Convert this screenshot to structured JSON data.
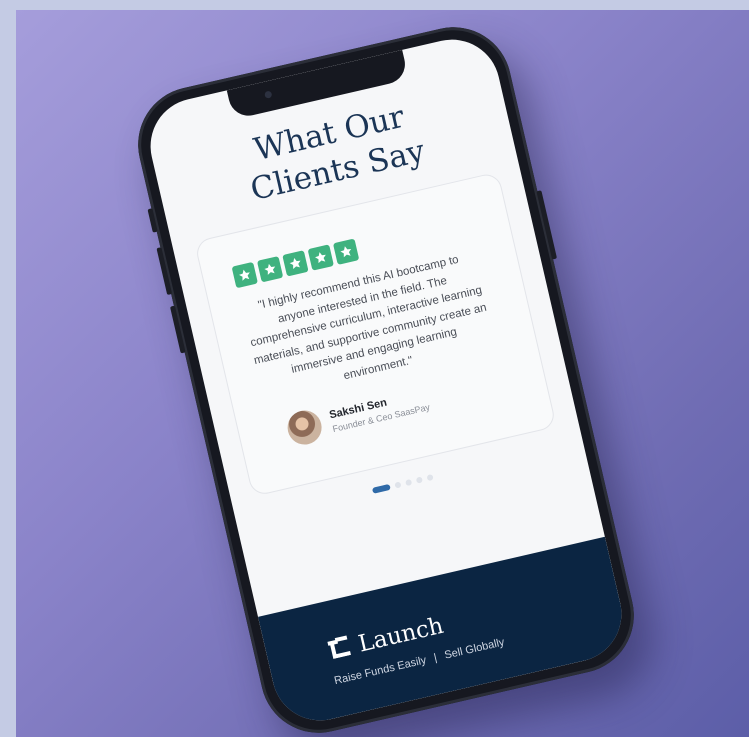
{
  "section": {
    "heading_line1": "What Our",
    "heading_line2": "Clients Say"
  },
  "testimonial": {
    "rating": 5,
    "rating_color": "#3fb27f",
    "quote": "\"I highly recommend this AI bootcamp to anyone interested in the field. The comprehensive curriculum, interactive learning materials, and supportive community create an immersive and engaging learning environment.\"",
    "author_name": "Sakshi Sen",
    "author_role": "Founder & Ceo SaasPay"
  },
  "carousel": {
    "total_slides": 5,
    "active_index": 1,
    "active_color": "#2f6aa8"
  },
  "footer": {
    "brand_name": "Launch",
    "tagline_left": "Raise Funds Easily",
    "tagline_separator": "|",
    "tagline_right": "Sell Globally",
    "background_color": "#0b2542"
  },
  "icons": {
    "star": "star-icon",
    "logo": "launch-logo-icon",
    "avatar": "avatar"
  }
}
